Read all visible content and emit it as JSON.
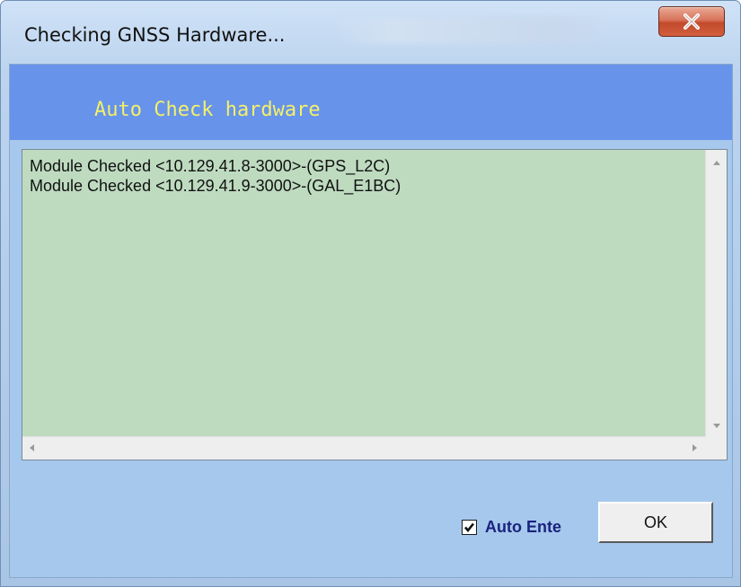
{
  "window": {
    "title": "Checking GNSS Hardware...",
    "close_icon": "close-icon"
  },
  "banner": {
    "text": "Auto Check hardware",
    "background": "#6793ea",
    "text_color": "#f4f06a"
  },
  "log": {
    "background": "#bedbc0",
    "lines": [
      "Module Checked <10.129.41.8-3000>-(GPS_L2C)",
      "Module Checked <10.129.41.9-3000>-(GAL_E1BC)"
    ]
  },
  "footer": {
    "auto_enter_label": "Auto Ente",
    "auto_enter_checked": true,
    "ok_label": "OK"
  }
}
